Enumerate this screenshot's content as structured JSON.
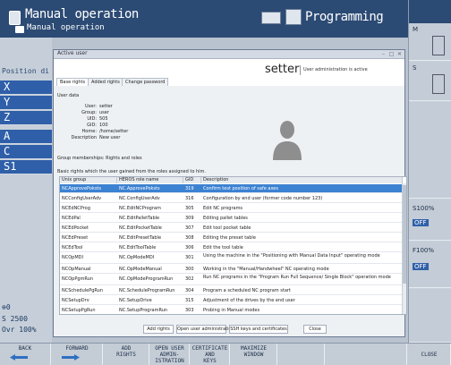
{
  "header": {
    "mode_title": "Manual operation",
    "mode_subtitle": "Manual operation",
    "program_title": "Programming"
  },
  "left_panel": {
    "position_label": "Position di",
    "axes": [
      "X",
      "Y",
      "Z",
      "A",
      "C",
      "S1"
    ],
    "status_1": "⊕0",
    "status_2": "S 2500",
    "status_3": "Ovr 100%"
  },
  "right_panel": {
    "labels": [
      "M",
      "S",
      "S100%",
      "F100%"
    ],
    "off_1": "OFF",
    "off_2": "OFF"
  },
  "window": {
    "title": "Active user",
    "tabs": [
      "Base rights",
      "Added rights",
      "Change password"
    ],
    "brand": "setter",
    "status": "User administration is active",
    "user_data_label": "User data",
    "fields": [
      {
        "key": "User:",
        "value": "setter"
      },
      {
        "key": "Group:",
        "value": "user"
      },
      {
        "key": "UID:",
        "value": "505"
      },
      {
        "key": "GID:",
        "value": "100"
      },
      {
        "key": "Home:",
        "value": "/home/setter"
      },
      {
        "key": "Description",
        "value": "New user"
      }
    ],
    "group_label": "Group memberships: Rights and roles",
    "roles_label": "Basic rights which the user gained from the roles assigned to him.",
    "table": {
      "columns": [
        "Unix group",
        "HEROS role name",
        "GID",
        "Description"
      ],
      "rows": [
        [
          "NCApprovePoksts",
          "NC.ApprovePoksts",
          "319",
          "Confirm test position of safe axes"
        ],
        [
          "NCConfigUserAdv",
          "NC.ConfigUserAdv",
          "316",
          "Configuration by end user (former code number 123)"
        ],
        [
          "NCEdNCProg",
          "NC.EditNCProgram",
          "305",
          "Edit NC programs"
        ],
        [
          "NCEdPal",
          "NC.EditPalletTable",
          "309",
          "Editing pallet tables"
        ],
        [
          "NCEdPocket",
          "NC.EditPocketTable",
          "307",
          "Edit tool pocket table"
        ],
        [
          "NCEdPreset",
          "NC.EditPresetTable",
          "308",
          "Editing the preset table"
        ],
        [
          "NCEdTool",
          "NC.EditToolTable",
          "306",
          "Edit the tool table"
        ],
        [
          "NCOpMDI",
          "NC.OpModeMDI",
          "301",
          "Using the machine in the \"Positioning with Manual Data Input\" operating mode"
        ],
        [
          "NCOpManual",
          "NC.OpModeManual",
          "300",
          "Working in the \"Manual/Handwheel\" NC operating mode"
        ],
        [
          "NCOpPgmRun",
          "NC.OpModeProgramRun",
          "302",
          "Run NC programs in the \"Program Run Full Sequence/ Single Block\" operation mode"
        ],
        [
          "NCSchedulePgRun",
          "NC.ScheduleProgramRun",
          "304",
          "Program a scheduled NC program start"
        ],
        [
          "NCSetupDrv",
          "NC.SetupDrive",
          "315",
          "Adjustment of the drives by the end user"
        ],
        [
          "NCSetupPgRun",
          "NC.SetupProgramRun",
          "303",
          "Probing in Manual modes"
        ]
      ]
    },
    "buttons": [
      "Add rights",
      "Open user administration",
      "SSH keys and certificates",
      "Close"
    ]
  },
  "softkeys": [
    {
      "label": "BACK"
    },
    {
      "label": "FORWARD"
    },
    {
      "label": "ADD\nRIGHTS"
    },
    {
      "label": "OPEN USER\nADMIN-\nISTRATION"
    },
    {
      "label": "CERTIFICATE\nAND\nKEYS"
    },
    {
      "label": "MAXIMIZE\nWINDOW"
    },
    {
      "label": ""
    },
    {
      "label": ""
    },
    {
      "label": "CLOSE"
    }
  ],
  "colors": {
    "topbar": "#2b4a74",
    "axis_highlight": "#2f5fa8",
    "selection": "#3c82d2"
  }
}
